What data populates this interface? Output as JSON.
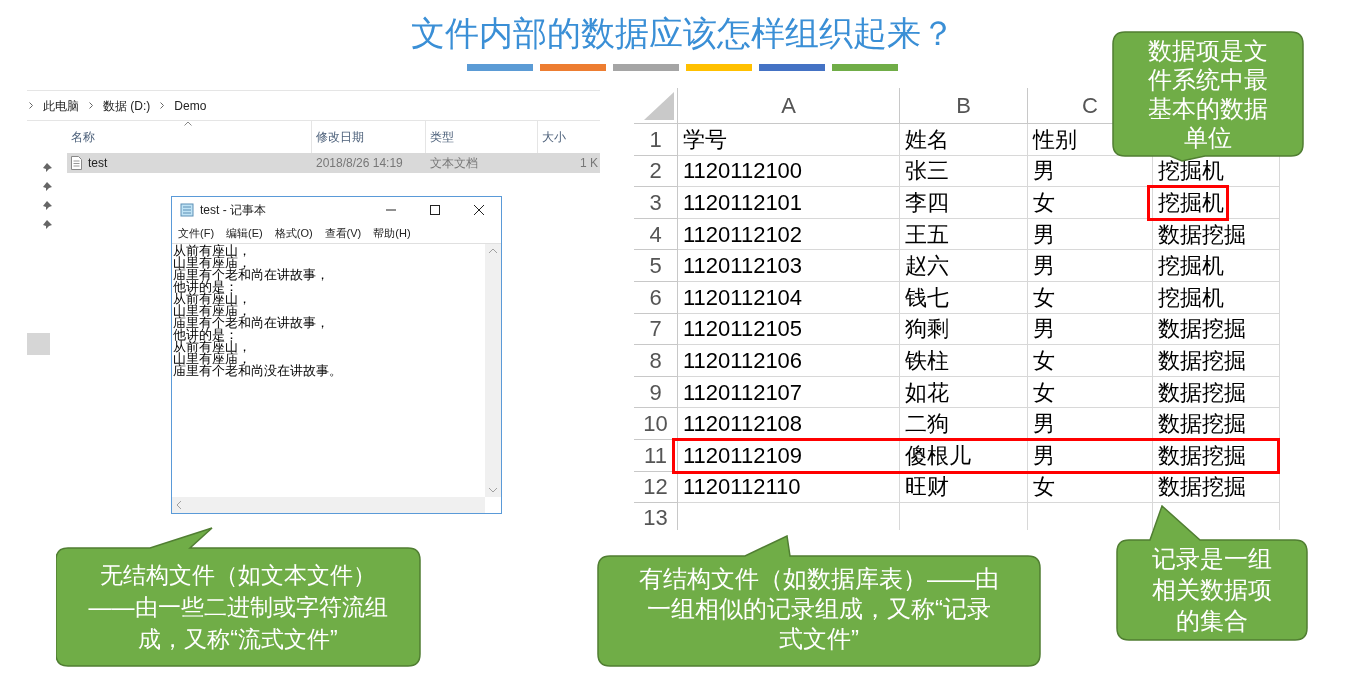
{
  "slide_title": "文件内部的数据应该怎样组织起来？",
  "accent_bars": [
    {
      "color": "#5b9bd5"
    },
    {
      "color": "#ed7d31"
    },
    {
      "color": "#a5a5a5"
    },
    {
      "color": "#ffc000"
    },
    {
      "color": "#4472c4"
    },
    {
      "color": "#70ad47"
    }
  ],
  "explorer": {
    "breadcrumb": [
      "此电脑",
      "数据 (D:)",
      "Demo"
    ],
    "columns": [
      "名称",
      "修改日期",
      "类型",
      "大小"
    ],
    "files": [
      {
        "name": "test",
        "modified": "2018/8/26 14:19",
        "type": "文本文档",
        "size": "1 K",
        "selected": true
      }
    ]
  },
  "notepad": {
    "title": "test - 记事本",
    "menu": [
      "文件(F)",
      "编辑(E)",
      "格式(O)",
      "查看(V)",
      "帮助(H)"
    ],
    "lines": [
      "从前有座山，",
      "山里有座庙，",
      "庙里有个老和尚在讲故事，",
      "他讲的是：",
      "从前有座山，",
      "山里有座庙，",
      "庙里有个老和尚在讲故事，",
      "他讲的是：",
      "从前有座山，",
      "山里有座庙，",
      "庙里有个老和尚没在讲故事。"
    ]
  },
  "spreadsheet": {
    "columns": [
      "A",
      "B",
      "C"
    ],
    "rows": [
      {
        "number": "1",
        "cells": [
          "学号",
          "姓名",
          "性别"
        ],
        "row_highlighted": false,
        "last_cell_highlighted": false
      },
      {
        "number": "2",
        "cells": [
          "1120112100",
          "张三",
          "男",
          "挖掘机"
        ],
        "row_highlighted": false,
        "last_cell_highlighted": false
      },
      {
        "number": "3",
        "cells": [
          "1120112101",
          "李四",
          "女",
          "挖掘机"
        ],
        "row_highlighted": false,
        "last_cell_highlighted": true
      },
      {
        "number": "4",
        "cells": [
          "1120112102",
          "王五",
          "男",
          "数据挖掘"
        ],
        "row_highlighted": false,
        "last_cell_highlighted": false
      },
      {
        "number": "5",
        "cells": [
          "1120112103",
          "赵六",
          "男",
          "挖掘机"
        ],
        "row_highlighted": false,
        "last_cell_highlighted": false
      },
      {
        "number": "6",
        "cells": [
          "1120112104",
          "钱七",
          "女",
          "挖掘机"
        ],
        "row_highlighted": false,
        "last_cell_highlighted": false
      },
      {
        "number": "7",
        "cells": [
          "1120112105",
          "狗剩",
          "男",
          "数据挖掘"
        ],
        "row_highlighted": false,
        "last_cell_highlighted": false
      },
      {
        "number": "8",
        "cells": [
          "1120112106",
          "铁柱",
          "女",
          "数据挖掘"
        ],
        "row_highlighted": false,
        "last_cell_highlighted": false
      },
      {
        "number": "9",
        "cells": [
          "1120112107",
          "如花",
          "女",
          "数据挖掘"
        ],
        "row_highlighted": false,
        "last_cell_highlighted": false
      },
      {
        "number": "10",
        "cells": [
          "1120112108",
          "二狗",
          "男",
          "数据挖掘"
        ],
        "row_highlighted": false,
        "last_cell_highlighted": false
      },
      {
        "number": "11",
        "cells": [
          "1120112109",
          "傻根儿",
          "男",
          "数据挖掘"
        ],
        "row_highlighted": true,
        "last_cell_highlighted": false
      },
      {
        "number": "12",
        "cells": [
          "1120112110",
          "旺财",
          "女",
          "数据挖掘"
        ],
        "row_highlighted": false,
        "last_cell_highlighted": false
      },
      {
        "number": "13",
        "cells": [],
        "row_highlighted": false,
        "last_cell_highlighted": false
      }
    ]
  },
  "callouts": [
    {
      "text": "无结构文件（如文本文件）——由一些二进制或字符流组成，又称“流式文件”"
    },
    {
      "text": "有结构文件（如数据库表）——由一组相似的记录组成，又称“记录式文件”"
    },
    {
      "text": "数据项是文件系统中最基本的数据单位"
    },
    {
      "text": "记录是一组相关数据项的集合"
    }
  ]
}
